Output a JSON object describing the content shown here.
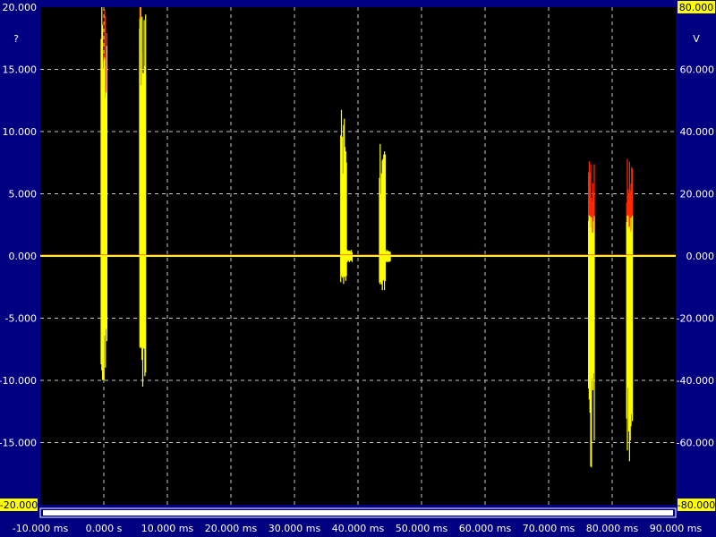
{
  "chart_data": {
    "type": "line",
    "title": "",
    "xlabel": "",
    "ylabel_left": "",
    "ylabel_right": "",
    "left_unit": "?",
    "right_unit": "V",
    "x_unit": "ms",
    "xlim": [
      -10,
      90
    ],
    "ylim_left": [
      -20,
      20
    ],
    "ylim_right": [
      -80,
      80
    ],
    "grid": true,
    "x_ticks": [
      "-10.000 ms",
      "0.000 s",
      "10.000 ms",
      "20.000 ms",
      "30.000 ms",
      "40.000 ms",
      "50.000 ms",
      "60.000 ms",
      "70.000 ms",
      "80.000 ms",
      "90.000 ms"
    ],
    "y_ticks_left": [
      "20.000",
      "15.000",
      "10.000",
      "5.000",
      "0.000",
      "-5.000",
      "-10.000",
      "-15.000",
      "-20.000"
    ],
    "y_ticks_right": [
      "80.000",
      "60.000",
      "40.000",
      "20.000",
      "0.000",
      "-20.000",
      "-40.000",
      "-60.000",
      "-80.000"
    ],
    "trigger_time_ms": 0,
    "series": [
      {
        "color": "#ff2a00",
        "axis": "left",
        "bursts": [
          {
            "t": 0.0,
            "max": 20.0,
            "min": 0.0
          },
          {
            "t": 6.0,
            "max": 20.0,
            "min": 0.0
          },
          {
            "t": 76.7,
            "max": 7.6,
            "min": 0.0
          },
          {
            "t": 82.7,
            "max": 7.8,
            "min": 0.0
          }
        ]
      },
      {
        "color": "#ffff00",
        "axis": "right",
        "baseline": 0,
        "bursts": [
          {
            "t": 0.0,
            "max": 80.0,
            "min": -40.0
          },
          {
            "t": 6.1,
            "max": 80.0,
            "min": -42.0
          },
          {
            "t": 37.7,
            "max": 47.0,
            "min": -9.0
          },
          {
            "t": 38.6,
            "max": 2.0,
            "min": -2.0
          },
          {
            "t": 43.8,
            "max": 36.0,
            "min": -11.0
          },
          {
            "t": 44.6,
            "max": 2.0,
            "min": -2.0
          },
          {
            "t": 76.7,
            "max": 13.0,
            "min": -68.0
          },
          {
            "t": 82.7,
            "max": 13.0,
            "min": -66.0
          }
        ]
      }
    ]
  },
  "colors": {
    "background": "#000080",
    "plot_background": "#000000",
    "grid": "#c8c8c8",
    "trace_left": "#ff2a00",
    "trace_right": "#ffff00",
    "badge": "#ffff00"
  }
}
